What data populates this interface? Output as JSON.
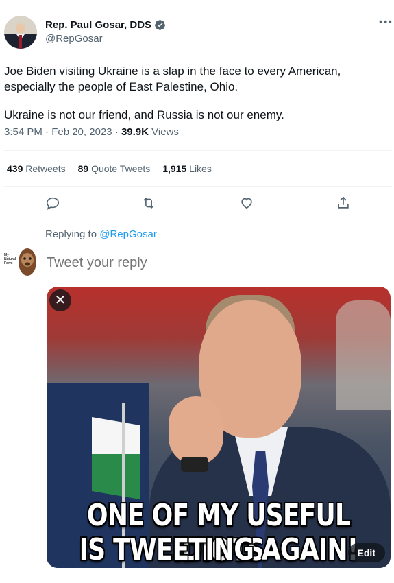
{
  "author": {
    "name": "Rep. Paul Gosar, DDS",
    "handle": "@RepGosar",
    "more_icon": "more-horizontal-icon",
    "verified_color": "#536471"
  },
  "tweet": {
    "paragraph1": "Joe Biden visiting Ukraine is a slap in the face to every American, especially the people of East Palestine, Ohio.",
    "paragraph2": "Ukraine is not our friend, and Russia is not our enemy.",
    "time": "3:54 PM · Feb 20, 2023 · ",
    "views_count": "39.9K",
    "views_label": " Views"
  },
  "stats": {
    "retweets_count": "439",
    "retweets_label": "Retweets",
    "quotes_count": "89",
    "quotes_label": "Quote Tweets",
    "likes_count": "1,915",
    "likes_label": "Likes"
  },
  "actions": [
    "reply-icon",
    "retweet-icon",
    "like-icon",
    "share-icon"
  ],
  "reply": {
    "replying_prefix": "Replying to ",
    "replying_handle": "@RepGosar",
    "placeholder": "Tweet your reply",
    "avatar_text": "My Natural Form"
  },
  "media": {
    "caption_line1": "ONE OF MY USEFUL IDIOTS",
    "caption_line2": "IS TWEETING AGAIN!",
    "close_label": "✕",
    "edit_label": "Edit"
  },
  "colors": {
    "link": "#1d9bf0",
    "muted": "#536471",
    "text": "#0f1419"
  }
}
